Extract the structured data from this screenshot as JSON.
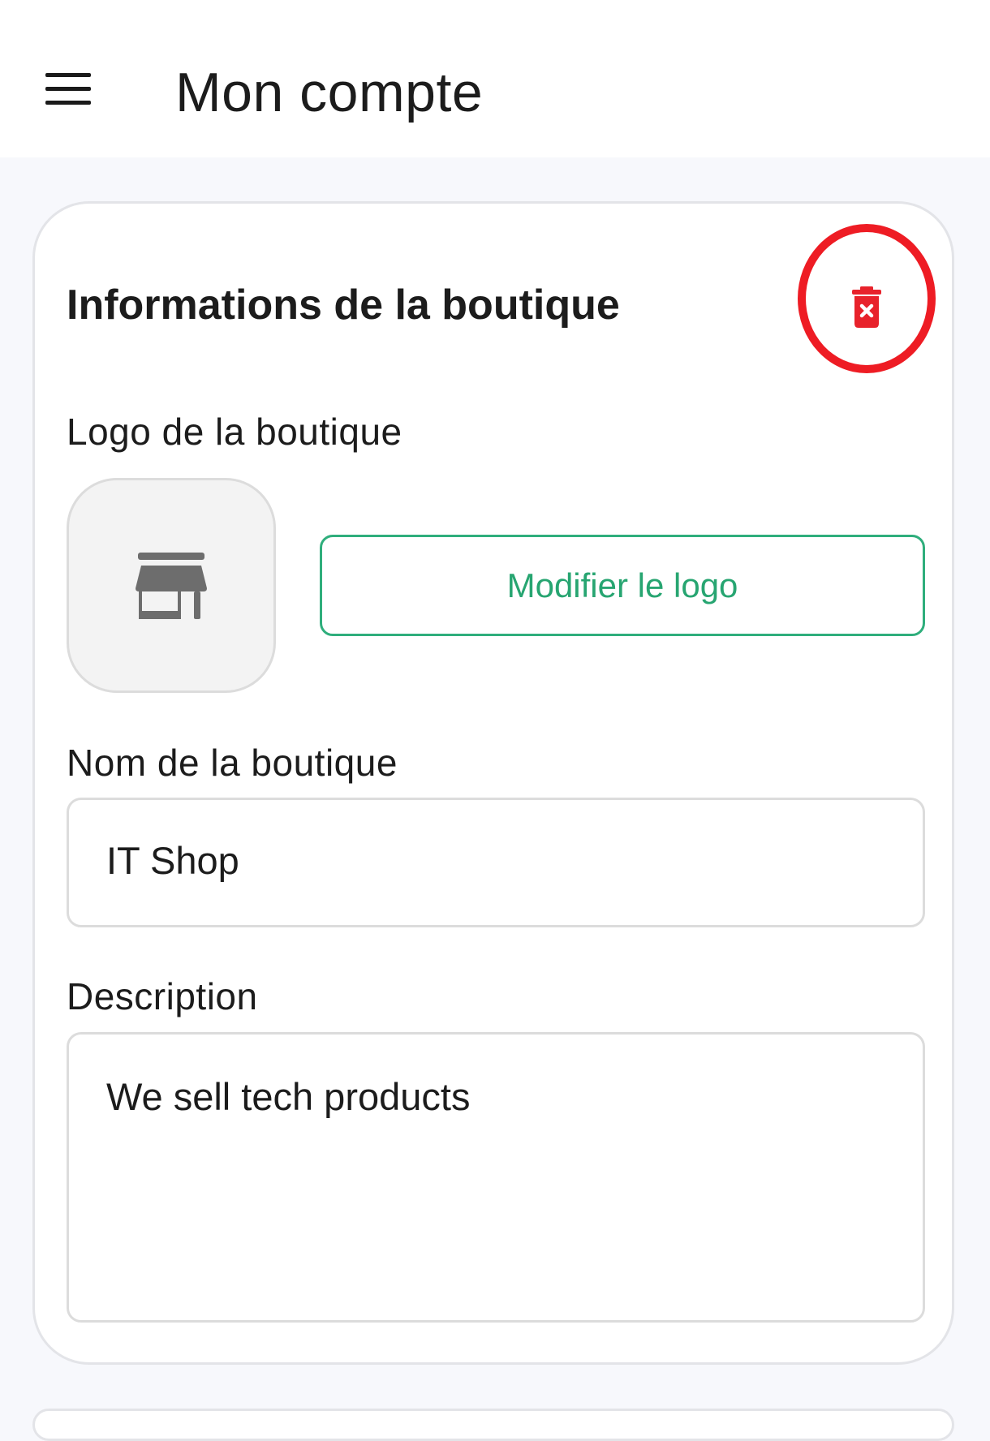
{
  "app_bar": {
    "title": "Mon compte",
    "menu_icon": "hamburger-menu-icon"
  },
  "shop_card": {
    "title": "Informations de la boutique",
    "delete_icon": "trash-delete-icon",
    "delete_icon_color": "#e8222b",
    "highlight_color": "#ee1c24",
    "logo": {
      "label": "Logo de la boutique",
      "placeholder_icon": "storefront-icon",
      "modify_button_label": "Modifier le logo",
      "accent_color": "#27a571"
    },
    "name": {
      "label": "Nom de la boutique",
      "value": "IT Shop"
    },
    "description": {
      "label": "Description",
      "value": "We sell tech products"
    }
  }
}
